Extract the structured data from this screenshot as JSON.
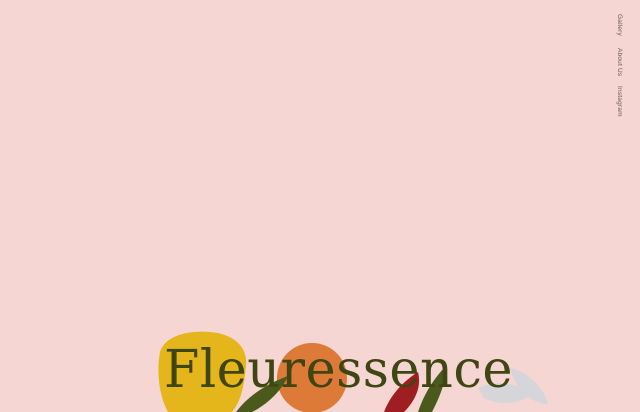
{
  "nav": {
    "items": [
      {
        "label": "Gallery"
      },
      {
        "label": "About Us"
      },
      {
        "label": "Instagram"
      }
    ]
  },
  "brand": {
    "name": "Fleuressence"
  },
  "colors": {
    "background": "#f5d6d3",
    "brand_text": "#3f4612",
    "yellow_blob": "#e5b51c",
    "orange_circle": "#dd7a37",
    "leaf_green": "#4a5a1c",
    "red_petal": "#9e1e22",
    "grey_leaf": "#d6d5d9"
  }
}
